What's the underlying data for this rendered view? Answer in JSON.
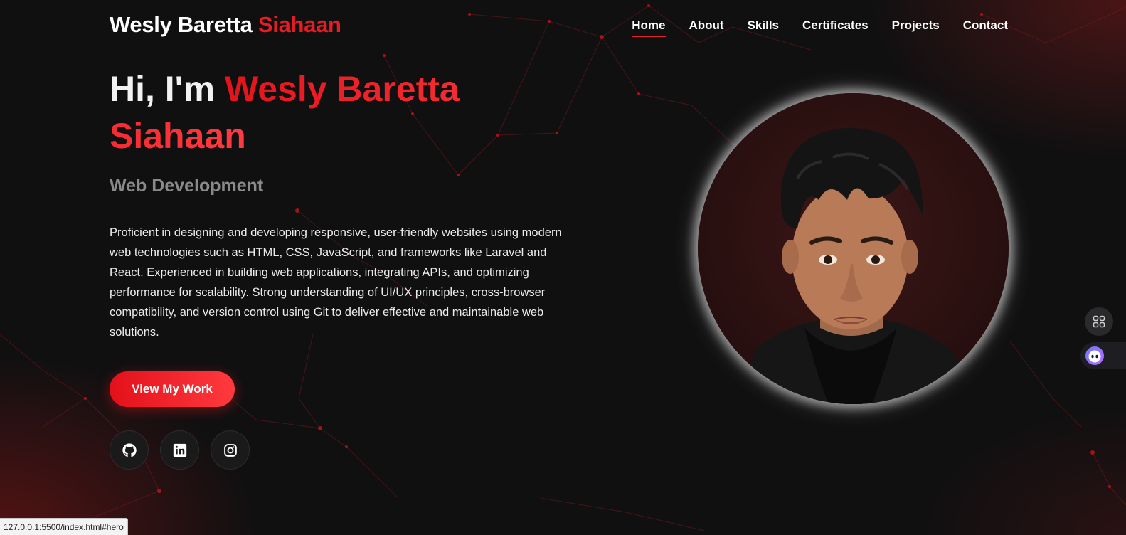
{
  "brand": {
    "first": "Wesly Baretta",
    "last": "Siahaan",
    "accent_color": "#e81c24"
  },
  "nav": {
    "items": [
      {
        "label": "Home",
        "active": true
      },
      {
        "label": "About",
        "active": false
      },
      {
        "label": "Skills",
        "active": false
      },
      {
        "label": "Certificates",
        "active": false
      },
      {
        "label": "Projects",
        "active": false
      },
      {
        "label": "Contact",
        "active": false
      }
    ]
  },
  "hero": {
    "greeting": "Hi, I'm",
    "name": "Wesly Baretta Siahaan",
    "subtitle": "Web Development",
    "description": "Proficient in designing and developing responsive, user-friendly websites using modern web technologies such as HTML, CSS, JavaScript, and frameworks like Laravel and React. Experienced in building web applications, integrating APIs, and optimizing performance for scalability. Strong understanding of UI/UX principles, cross-browser compatibility, and version control using Git to deliver effective and maintainable web solutions.",
    "cta_label": "View My Work"
  },
  "socials": [
    {
      "icon": "github-icon"
    },
    {
      "icon": "linkedin-icon"
    },
    {
      "icon": "instagram-icon"
    }
  ],
  "side_widgets": [
    {
      "icon": "apps-grid-icon"
    },
    {
      "icon": "assistant-face-icon"
    }
  ],
  "status_bar": {
    "url": "127.0.0.1:5500/index.html#hero"
  }
}
